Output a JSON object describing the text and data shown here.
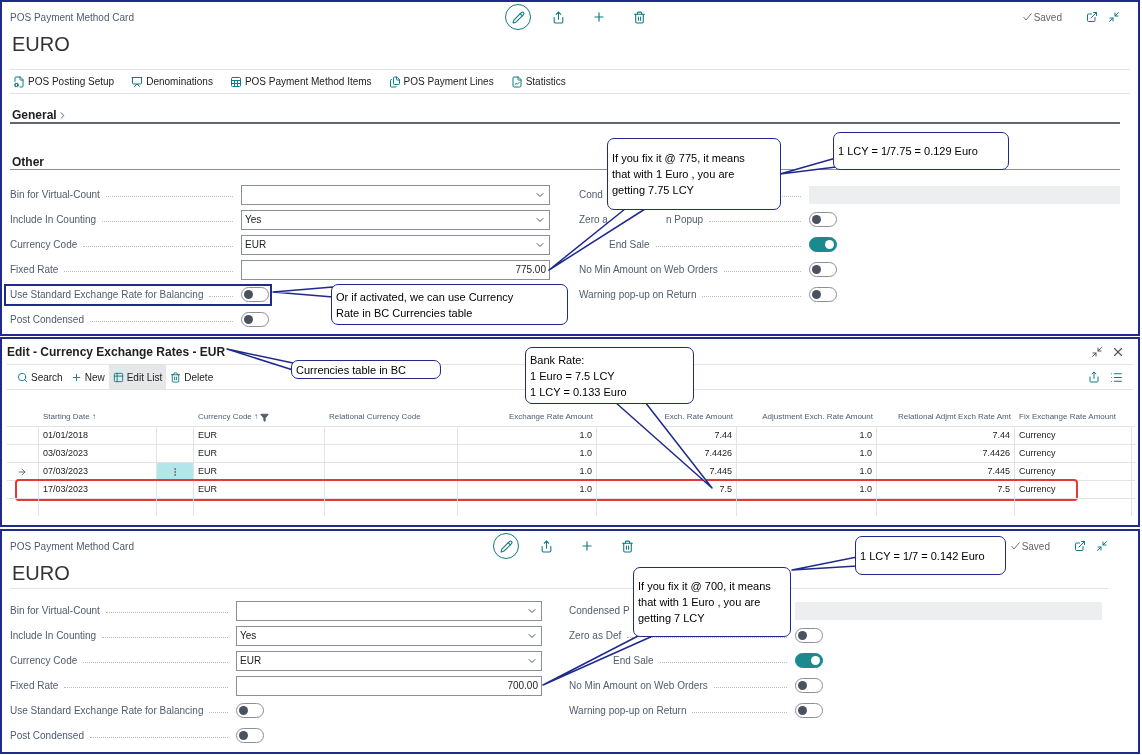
{
  "cards": [
    {
      "caption": "POS Payment Method Card",
      "title": "EURO",
      "status": "Saved",
      "actions": [
        "POS Posting Setup",
        "Denominations",
        "POS Payment Method Items",
        "POS Payment Lines",
        "Statistics"
      ],
      "sections": [
        {
          "title": "General",
          "collapsed": true
        },
        {
          "title": "Other",
          "collapsed": false
        }
      ],
      "left_fields": [
        {
          "label": "Bin for Virtual-Count",
          "kind": "dropdown",
          "highlighted": false
        },
        {
          "label": "Include In Counting",
          "kind": "dropdown",
          "value": "Yes",
          "highlighted": false
        },
        {
          "label": "Currency Code",
          "kind": "dropdown",
          "value": "EUR",
          "highlighted": false
        },
        {
          "label": "Fixed Rate",
          "kind": "number",
          "value": "775.00",
          "highlighted": false
        },
        {
          "label": "Use Standard Exchange Rate for Balancing",
          "kind": "toggle",
          "on": false,
          "highlighted": true
        },
        {
          "label": "Post Condensed",
          "kind": "toggle",
          "on": false,
          "highlighted": false
        }
      ],
      "right_fields": [
        {
          "label": "Cond",
          "kind": "readonly"
        },
        {
          "label": "Zero a",
          "label_after": "n Popup",
          "kind": "toggle",
          "on": false
        },
        {
          "label": "End Sale",
          "kind": "toggle",
          "on": true
        },
        {
          "label": "No Min Amount on Web Orders",
          "kind": "toggle",
          "on": false
        },
        {
          "label": "Warning pop-up on Return",
          "kind": "toggle",
          "on": false
        }
      ]
    },
    {
      "caption": "POS Payment Method Card",
      "title": "EURO",
      "status": "Saved",
      "left_fields": [
        {
          "label": "Bin for Virtual-Count",
          "kind": "dropdown",
          "highlighted": false
        },
        {
          "label": "Include In Counting",
          "kind": "dropdown",
          "value": "Yes",
          "highlighted": false
        },
        {
          "label": "Currency Code",
          "kind": "dropdown",
          "value": "EUR",
          "highlighted": false
        },
        {
          "label": "Fixed Rate",
          "kind": "number",
          "value": "700.00",
          "highlighted": false
        },
        {
          "label": "Use Standard Exchange Rate for Balancing",
          "kind": "toggle",
          "on": false,
          "highlighted": false
        },
        {
          "label": "Post Condensed",
          "kind": "toggle",
          "on": false,
          "highlighted": false
        }
      ],
      "right_fields": [
        {
          "label": "Condensed P",
          "kind": "readonly"
        },
        {
          "label": "Zero as Def",
          "kind": "toggle",
          "on": false
        },
        {
          "label": "End Sale",
          "kind": "toggle",
          "on": true
        },
        {
          "label": "No Min Amount on Web Orders",
          "kind": "toggle",
          "on": false
        },
        {
          "label": "Warning pop-up on Return",
          "kind": "toggle",
          "on": false
        }
      ]
    }
  ],
  "rates_page": {
    "title": "Edit - Currency Exchange Rates - EUR",
    "toolbar": [
      {
        "label": "Search",
        "selected": false
      },
      {
        "label": "New",
        "selected": false
      },
      {
        "label": "Edit List",
        "selected": true
      },
      {
        "label": "Delete",
        "selected": false
      }
    ],
    "columns": [
      "Starting Date ↑",
      "Currency Code ↑",
      "Relational Currency Code",
      "Exchange Rate Amount",
      "Exch. Rate Amount",
      "Adjustment Exch. Rate Amount",
      "Relational Adjmt Exch Rate Amt",
      "Fix Exchange Rate Amount"
    ],
    "currency_filtered": true,
    "rows": [
      {
        "selected": false,
        "highlighted": false,
        "starting_date": "01/01/2018",
        "currency_code": "EUR",
        "exchange_rate_amount": "1.0",
        "column_5": "7.44",
        "adjustment_exch_rate_amount": "1.0",
        "relational_adjmt_exch_rate_amt": "7.44",
        "fix_exchange_rate_amount": "Currency"
      },
      {
        "selected": false,
        "highlighted": false,
        "starting_date": "03/03/2023",
        "currency_code": "EUR",
        "exchange_rate_amount": "1.0",
        "column_5": "7.4426",
        "adjustment_exch_rate_amount": "1.0",
        "relational_adjmt_exch_rate_amt": "7.4426",
        "fix_exchange_rate_amount": "Currency"
      },
      {
        "selected": true,
        "highlighted": false,
        "starting_date": "07/03/2023",
        "currency_code": "EUR",
        "exchange_rate_amount": "1.0",
        "column_5": "7.445",
        "adjustment_exch_rate_amount": "1.0",
        "relational_adjmt_exch_rate_amt": "7.445",
        "fix_exchange_rate_amount": "Currency"
      },
      {
        "selected": false,
        "highlighted": true,
        "starting_date": "17/03/2023",
        "currency_code": "EUR",
        "exchange_rate_amount": "1.0",
        "column_5": "7.5",
        "adjustment_exch_rate_amount": "1.0",
        "relational_adjmt_exch_rate_amt": "7.5",
        "fix_exchange_rate_amount": "Currency"
      }
    ]
  },
  "callouts": [
    {
      "lines": [
        "If you fix it @ 775, it means",
        "that with 1 Euro , you are",
        "getting 7.75 LCY"
      ]
    },
    {
      "lines": [
        "1 LCY = 1/7.75 = 0.129 Euro"
      ]
    },
    {
      "lines": [
        "Or if activated, we can use Currency",
        "Rate in BC Currencies table"
      ]
    },
    {
      "lines": [
        "Currencies table in BC"
      ]
    },
    {
      "lines": [
        "Bank Rate:",
        "1 Euro = 7.5 LCY",
        "1 LCY  = 0.133 Euro"
      ]
    },
    {
      "lines": [
        "1 LCY = 1/7 = 0.142 Euro"
      ]
    },
    {
      "lines": [
        "If you fix it @ 700, it means",
        "that with 1 Euro , you are",
        "getting 7 LCY"
      ]
    }
  ]
}
